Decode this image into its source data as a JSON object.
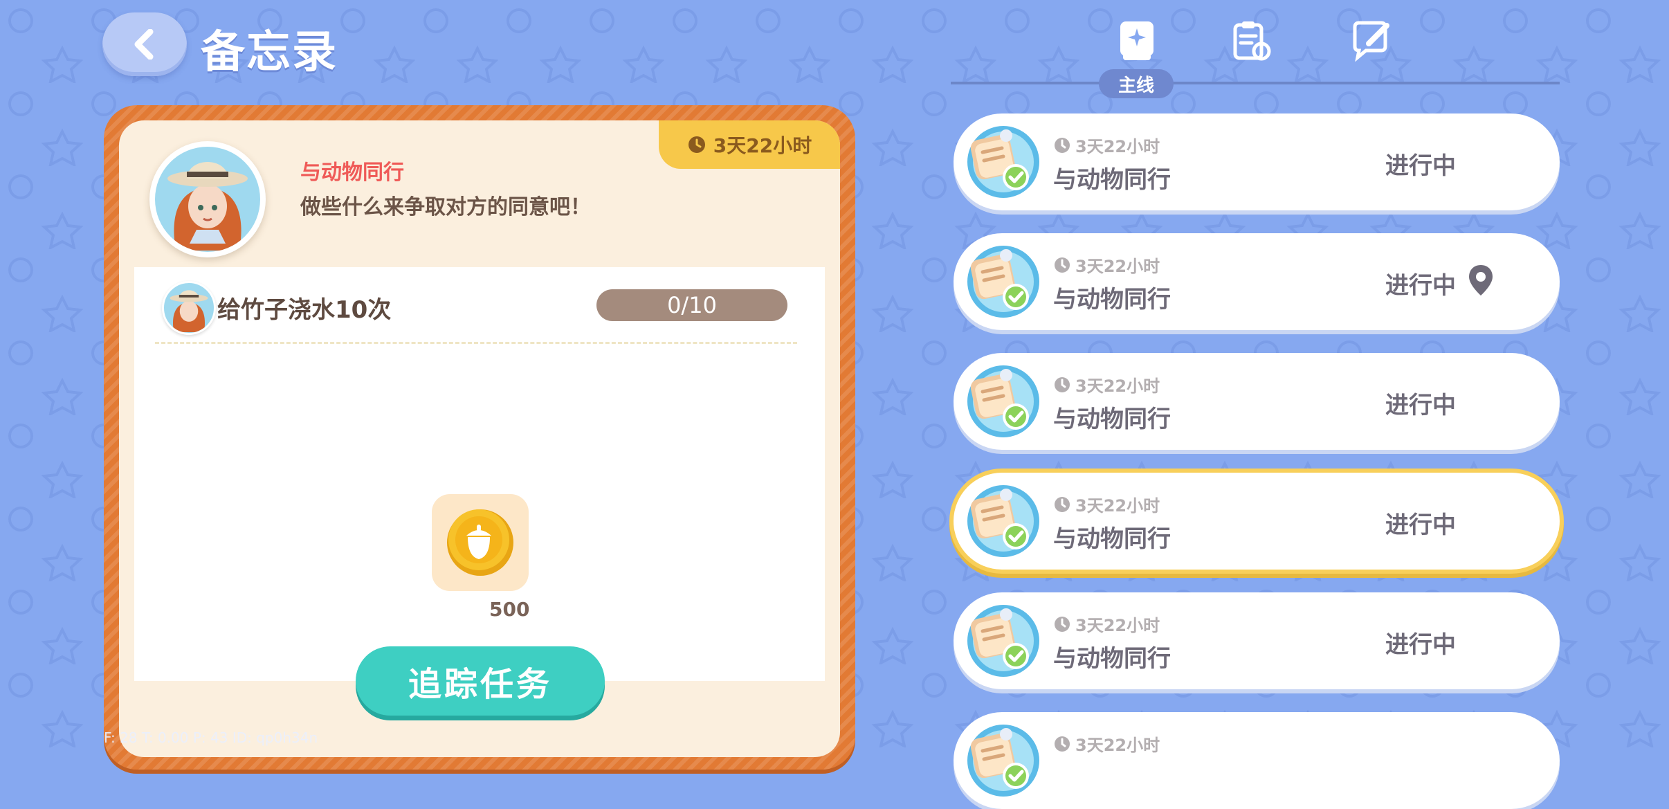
{
  "header": {
    "title": "备忘录"
  },
  "tabs": {
    "active_label": "主线"
  },
  "quest": {
    "time_left": "3天22小时",
    "name": "与动物同行",
    "description": "做些什么来争取对方的同意吧！",
    "task": {
      "text": "给竹子浇水10次",
      "progress": "0/10"
    },
    "reward": {
      "count": "500"
    },
    "track_label": "追踪任务"
  },
  "debug_text": "F: 28    T: 0.00    P: 43    ID: qp0h34n",
  "list": [
    {
      "time": "3天22小时",
      "name": "与动物同行",
      "status": "进行中"
    },
    {
      "time": "3天22小时",
      "name": "与动物同行",
      "status": "进行中"
    },
    {
      "time": "3天22小时",
      "name": "与动物同行",
      "status": "进行中"
    },
    {
      "time": "3天22小时",
      "name": "与动物同行",
      "status": "进行中"
    },
    {
      "time": "3天22小时",
      "name": "与动物同行",
      "status": "进行中"
    },
    {
      "time": "3天22小时"
    }
  ],
  "colors": {
    "background": "#86a8f0",
    "card_frame": "#e27a34",
    "accent_teal": "#3ecfc2",
    "selected_outline": "#f8cf5a"
  },
  "icons": [
    "back-arrow-icon",
    "clock-icon",
    "main-quest-tab-icon",
    "clipboard-refresh-tab-icon",
    "chat-edit-tab-icon",
    "location-pin-icon",
    "acorn-coin-icon",
    "quest-note-icon"
  ]
}
